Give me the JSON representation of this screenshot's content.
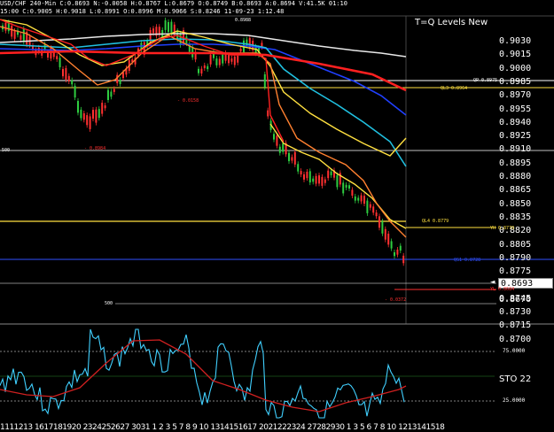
{
  "header": {
    "line1": "USD/CHF 240-Min  C:0.8693  N:-0.0058  H:0.8767  L:0.8679  O:0.8749  B:0.8693  A:0.8694  V:41.5K  01:10",
    "line2": "15:00  C:0.9005  H:0.9018  L:0.8991  O:0.8996  M:0.9066  S:0.8246  11-09-23  1:12.48"
  },
  "chart_title": "T=Q Levels New",
  "price_axis": [
    "0.9030",
    "0.9015",
    "0.9000",
    "0.8985",
    "0.8970",
    "0.8955",
    "0.8940",
    "0.8925",
    "0.8910",
    "0.8895",
    "0.8880",
    "0.8865",
    "0.8850",
    "0.8835",
    "0.8820",
    "0.8805",
    "0.8790",
    "0.8775",
    "0.8760",
    "0.8745",
    "0.8730",
    "0.8715",
    "0.8700",
    "0.8670"
  ],
  "current_price": "0.8693",
  "levels": {
    "qp": "QP 0.8975",
    "ql3": "QL3 0.8964",
    "ql4": "QL4 0.8779",
    "yh": "YH 0.8770",
    "qs1": "QS1 0.8728",
    "yl": "YL 0.8684",
    "diff1": "- 0.0372",
    "diff2": "- 0.0158",
    "high_mark": "0.8988",
    "low_mark": "- 0.8984",
    "mark500a": "500",
    "mark500b": "500"
  },
  "stochastic": {
    "label": "STO 22",
    "levels": [
      "75.0000",
      "25.0000"
    ]
  },
  "x_axis": "1111213 1617181920 2324252627 3031 1  2  3  5    7  8  9  10 1314151617 2021222324 27282930 1  3    5  6  7  8 10 1213141518",
  "colors": {
    "bg": "#000000",
    "candle_up": "#2ecc40",
    "candle_down": "#ff3030",
    "ma_white": "#e8e8e8",
    "ma_blue": "#2040ff",
    "ma_cyan": "#20c0e0",
    "ma_yellow": "#ffe040",
    "ma_orange": "#ff8030",
    "ma_red": "#ff2020",
    "stoch": "#40d0ff",
    "stoch_sig": "#d02020"
  }
}
